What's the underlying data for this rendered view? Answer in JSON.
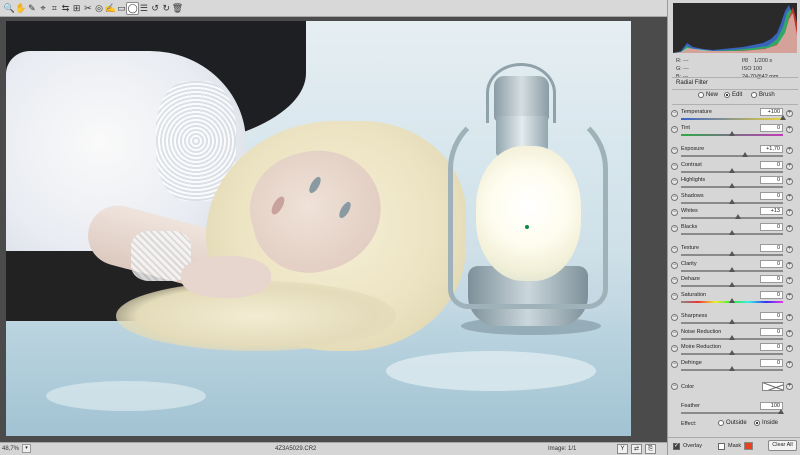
{
  "toolbar": {
    "tools": [
      {
        "name": "zoom-tool-icon",
        "glyph": "🔍"
      },
      {
        "name": "hand-tool-icon",
        "glyph": "✋"
      },
      {
        "name": "white-balance-icon",
        "glyph": "✎"
      },
      {
        "name": "color-sampler-icon",
        "glyph": "⌖"
      },
      {
        "name": "crop-icon",
        "glyph": "⌗"
      },
      {
        "name": "straighten-icon",
        "glyph": "⇆"
      },
      {
        "name": "transform-icon",
        "glyph": "⊞"
      },
      {
        "name": "spot-removal-icon",
        "glyph": "✂"
      },
      {
        "name": "red-eye-icon",
        "glyph": "◎"
      },
      {
        "name": "adjustment-brush-icon",
        "glyph": "✍"
      },
      {
        "name": "graduated-filter-icon",
        "glyph": "▭"
      },
      {
        "name": "radial-filter-icon",
        "glyph": "◯"
      },
      {
        "name": "preferences-icon",
        "glyph": "☰"
      },
      {
        "name": "rotate-left-icon",
        "glyph": "↺"
      },
      {
        "name": "rotate-right-icon",
        "glyph": "↻"
      },
      {
        "name": "trash-icon",
        "glyph": "🗑"
      }
    ],
    "menu_glyph": "▭"
  },
  "panel": {
    "title": "Radial Filter",
    "rgb": {
      "r": "R:",
      "g": "G:",
      "b": "B:",
      "dash": "---"
    },
    "exif": {
      "aperture": "f/8",
      "shutter": "1/200 s",
      "iso": "ISO 100",
      "lens": "24-70@42 mm"
    },
    "modes": [
      {
        "label": "New",
        "selected": false
      },
      {
        "label": "Edit",
        "selected": true
      },
      {
        "label": "Brush",
        "selected": false
      }
    ],
    "sliders": [
      {
        "label": "Temperature",
        "value": "+100",
        "pos": 1.0,
        "track": "temp"
      },
      {
        "label": "Tint",
        "value": "0",
        "pos": 0.5,
        "track": "tint"
      },
      {
        "label": "Exposure",
        "value": "+1,70",
        "pos": 0.63,
        "track": "plain"
      },
      {
        "label": "Contrast",
        "value": "0",
        "pos": 0.5,
        "track": "plain"
      },
      {
        "label": "Highlights",
        "value": "0",
        "pos": 0.5,
        "track": "plain"
      },
      {
        "label": "Shadows",
        "value": "0",
        "pos": 0.5,
        "track": "plain"
      },
      {
        "label": "Whites",
        "value": "+13",
        "pos": 0.56,
        "track": "plain"
      },
      {
        "label": "Blacks",
        "value": "0",
        "pos": 0.5,
        "track": "plain"
      },
      {
        "label": "Texture",
        "value": "0",
        "pos": 0.5,
        "track": "plain"
      },
      {
        "label": "Clarity",
        "value": "0",
        "pos": 0.5,
        "track": "plain"
      },
      {
        "label": "Dehaze",
        "value": "0",
        "pos": 0.5,
        "track": "plain"
      },
      {
        "label": "Saturation",
        "value": "0",
        "pos": 0.5,
        "track": "sat"
      },
      {
        "label": "Sharpness",
        "value": "0",
        "pos": 0.5,
        "track": "plain"
      },
      {
        "label": "Noise Reduction",
        "value": "0",
        "pos": 0.5,
        "track": "plain"
      },
      {
        "label": "Moire Reduction",
        "value": "0",
        "pos": 0.5,
        "track": "plain"
      },
      {
        "label": "Defringe",
        "value": "0",
        "pos": 0.5,
        "track": "plain"
      }
    ],
    "color_label": "Color",
    "feather_label": "Feather",
    "feather_value": "100",
    "effect_label": "Effect:",
    "effect_options": [
      {
        "label": "Outside",
        "selected": false
      },
      {
        "label": "Inside",
        "selected": true
      }
    ],
    "overlay_label": "Overlay",
    "overlay_checked": true,
    "mask_label": "Mask",
    "mask_checked": false,
    "mask_color": "#e8431c",
    "clear_all_label": "Clear All"
  },
  "status": {
    "zoom": "48,7%",
    "filename": "4Z3A5029.CR2",
    "image_label": "Image: 1/1",
    "y_button": "Y"
  },
  "colors": {
    "pin": "#0c8a3a",
    "panel_bg": "#d6d6d6",
    "canvas_bg": "#4b4b4b"
  }
}
